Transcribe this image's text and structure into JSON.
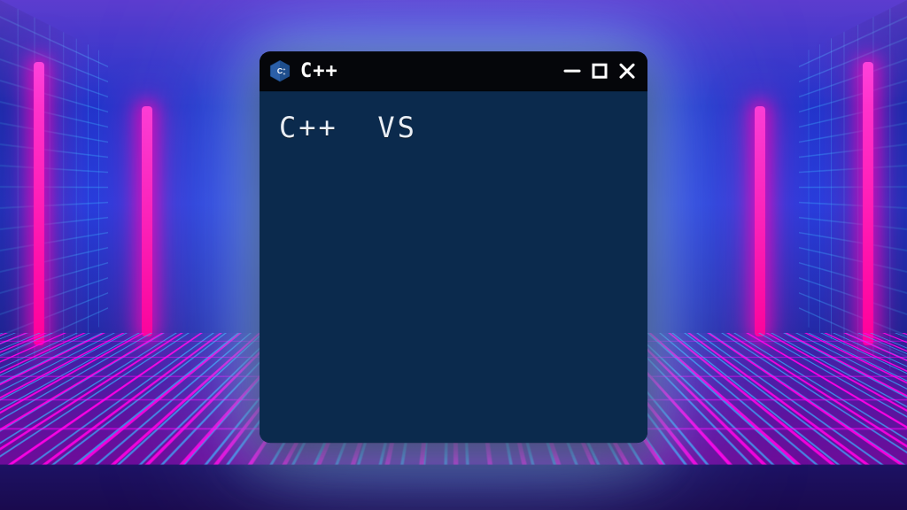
{
  "window": {
    "icon": "cpp-hex-icon",
    "title": "C++",
    "controls": {
      "minimize": "minimize-icon",
      "maximize": "maximize-icon",
      "close": "close-icon"
    }
  },
  "content": {
    "headline": "C++  VS"
  },
  "colors": {
    "titlebar_bg": "#05060a",
    "content_bg": "#0b2a4d",
    "text": "#e9eef5",
    "neon_pink": "#ff2bc6",
    "neon_blue": "#4ab8ff"
  }
}
